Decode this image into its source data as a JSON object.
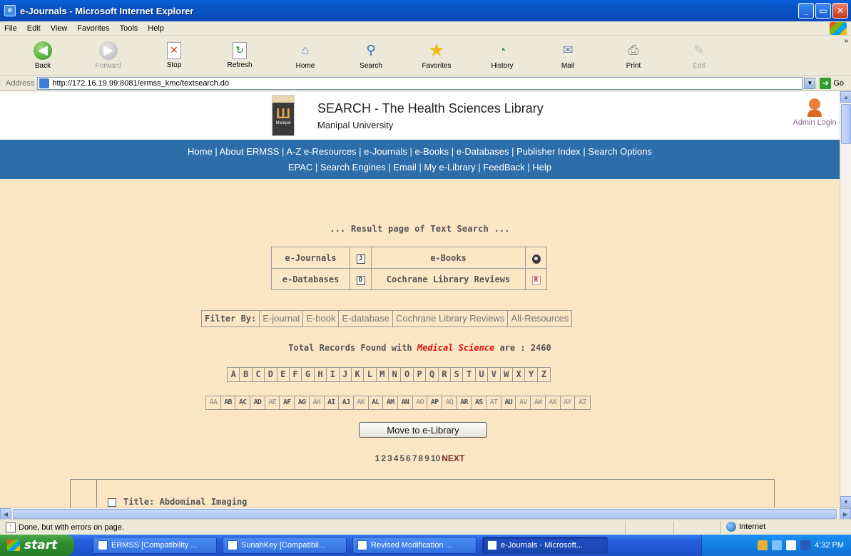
{
  "window": {
    "title": "e-Journals - Microsoft Internet Explorer",
    "btn_min": "_",
    "btn_max": "▭",
    "btn_close": "✕"
  },
  "menu": [
    "File",
    "Edit",
    "View",
    "Favorites",
    "Tools",
    "Help"
  ],
  "toolbar": [
    {
      "label": "Back",
      "icon": "back-arrow-icon",
      "glyph": "◀",
      "enabled": true
    },
    {
      "label": "Forward",
      "icon": "forward-arrow-icon",
      "glyph": "▶",
      "enabled": false
    },
    {
      "label": "Stop",
      "icon": "stop-icon",
      "glyph": "✕",
      "enabled": true
    },
    {
      "label": "Refresh",
      "icon": "refresh-icon",
      "glyph": "↻",
      "enabled": true
    },
    {
      "label": "Home",
      "icon": "home-icon",
      "glyph": "⌂",
      "enabled": true
    },
    {
      "label": "Search",
      "icon": "search-icon",
      "glyph": "⚲",
      "enabled": true
    },
    {
      "label": "Favorites",
      "icon": "favorites-star-icon",
      "glyph": "★",
      "enabled": true
    },
    {
      "label": "History",
      "icon": "history-icon",
      "glyph": "◔",
      "enabled": true
    },
    {
      "label": "Mail",
      "icon": "mail-icon",
      "glyph": "✉",
      "enabled": true
    },
    {
      "label": "Print",
      "icon": "print-icon",
      "glyph": "⎙",
      "enabled": true
    },
    {
      "label": "Edit",
      "icon": "edit-icon",
      "glyph": "✎",
      "enabled": false
    }
  ],
  "address": {
    "label": "Address",
    "url": "http://172.16.19.99:8081/ermss_kmc/textsearch.do",
    "go_label": "Go"
  },
  "header": {
    "title": "SEARCH - The Health Sciences Library",
    "subtitle": "Manipal University",
    "logo_text": "Manipal",
    "admin_label": "Admin Login"
  },
  "nav": {
    "row1": [
      "Home",
      "About ERMSS",
      "A-Z e-Resources",
      "e-Journals",
      "e-Books",
      "e-Databases",
      "Publisher Index",
      "Search Options"
    ],
    "row2": [
      "EPAC",
      "Search Engines",
      "Email",
      "My e-Library",
      "FeedBack",
      "Help"
    ]
  },
  "result_heading": "... Result page of Text Search ...",
  "resource_table": [
    [
      {
        "label": "e-Journals",
        "icon": "J"
      },
      {
        "label": "e-Books",
        "icon": "◉"
      }
    ],
    [
      {
        "label": "e-Databases",
        "icon": "D"
      },
      {
        "label": "Cochrane Library Reviews",
        "icon": "R"
      }
    ]
  ],
  "filter": {
    "label": "Filter By:",
    "options": [
      "E-journal",
      "E-book",
      "E-database",
      "Cochrane Library Reviews",
      "All-Resources"
    ]
  },
  "total": {
    "prefix": "Total Records Found with",
    "keyword": "Medical Science",
    "suffix": "are : 2460"
  },
  "alphabet": [
    "A",
    "B",
    "C",
    "D",
    "E",
    "F",
    "G",
    "H",
    "I",
    "J",
    "K",
    "L",
    "M",
    "N",
    "O",
    "P",
    "Q",
    "R",
    "S",
    "T",
    "U",
    "V",
    "W",
    "X",
    "Y",
    "Z"
  ],
  "alpha2": [
    {
      "t": "AA",
      "b": false
    },
    {
      "t": "AB",
      "b": true
    },
    {
      "t": "AC",
      "b": true
    },
    {
      "t": "AD",
      "b": true
    },
    {
      "t": "AE",
      "b": false
    },
    {
      "t": "AF",
      "b": true
    },
    {
      "t": "AG",
      "b": true
    },
    {
      "t": "AH",
      "b": false
    },
    {
      "t": "AI",
      "b": true
    },
    {
      "t": "AJ",
      "b": true
    },
    {
      "t": "AK",
      "b": false
    },
    {
      "t": "AL",
      "b": true
    },
    {
      "t": "AM",
      "b": true
    },
    {
      "t": "AN",
      "b": true
    },
    {
      "t": "AO",
      "b": false
    },
    {
      "t": "AP",
      "b": true
    },
    {
      "t": "AQ",
      "b": false
    },
    {
      "t": "AR",
      "b": true
    },
    {
      "t": "AS",
      "b": true
    },
    {
      "t": "AT",
      "b": false
    },
    {
      "t": "AU",
      "b": true
    },
    {
      "t": "AV",
      "b": false
    },
    {
      "t": "AW",
      "b": false
    },
    {
      "t": "AX",
      "b": false
    },
    {
      "t": "AY",
      "b": false
    },
    {
      "t": "AZ",
      "b": false
    }
  ],
  "move_button": "Move to e-Library",
  "pagination": {
    "pages": [
      "1",
      "2",
      "3",
      "4",
      "5",
      "6",
      "7",
      "8",
      "9",
      "10"
    ],
    "next": "NEXT"
  },
  "record": {
    "title": "Title: Abdominal Imaging"
  },
  "status": {
    "text": "Done, but with errors on page.",
    "zone": "Internet"
  },
  "taskbar": {
    "start": "start",
    "tasks": [
      {
        "label": "ERMSS [Compatibility ...",
        "active": false
      },
      {
        "label": "SunahKey [Compatibil...",
        "active": false
      },
      {
        "label": "Revised Modification ...",
        "active": false
      },
      {
        "label": "e-Journals - Microsoft...",
        "active": true
      }
    ],
    "clock": "4:32 PM"
  }
}
